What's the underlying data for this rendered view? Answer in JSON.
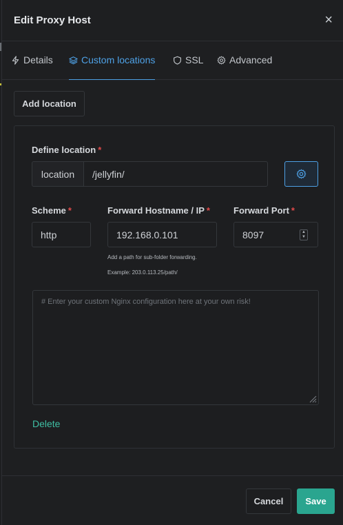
{
  "modal": {
    "title": "Edit Proxy Host",
    "close_glyph": "×"
  },
  "tabs": [
    {
      "label": "Details",
      "icon": "bolt-icon",
      "active": false
    },
    {
      "label": "Custom locations",
      "icon": "layers-icon",
      "active": true
    },
    {
      "label": "SSL",
      "icon": "shield-icon",
      "active": false
    },
    {
      "label": "Advanced",
      "icon": "gear-icon",
      "active": false
    }
  ],
  "add_location_label": "Add location",
  "location": {
    "define_label": "Define location",
    "required_mark": "*",
    "addon": "location",
    "path_value": "/jellyfin/",
    "settings_icon": "gear-icon"
  },
  "forward": {
    "scheme_label": "Scheme",
    "scheme_value": "http",
    "hostname_label": "Forward Hostname / IP",
    "hostname_value": "192.168.0.101",
    "port_label": "Forward Port",
    "port_value": "8097",
    "hint_line1": "Add a path for sub-folder forwarding.",
    "hint_line2": "Example: 203.0.113.25/path/"
  },
  "config": {
    "placeholder": "# Enter your custom Nginx configuration here at your own risk!"
  },
  "delete_label": "Delete",
  "footer": {
    "cancel_label": "Cancel",
    "save_label": "Save"
  },
  "colors": {
    "accent_blue": "#4ea1e6",
    "accent_teal": "#2aa58f",
    "required_red": "#e04a4a",
    "background": "#1e1f21"
  }
}
